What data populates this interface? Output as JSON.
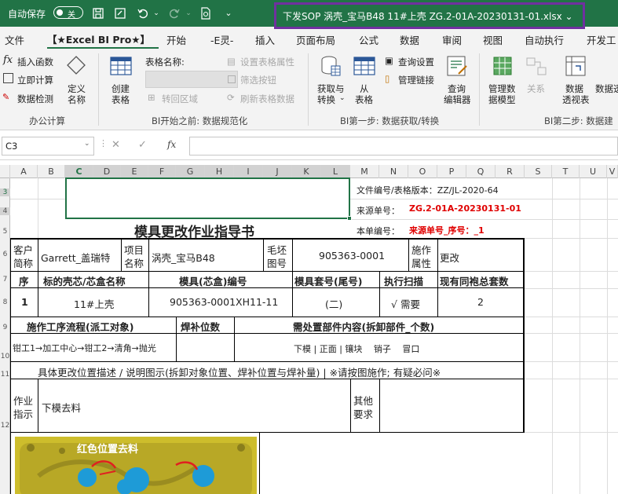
{
  "titlebar": {
    "autosave_label": "自动保存",
    "autosave_state": "关",
    "filename": "下发SOP 涡壳_宝马B48 11#上壳 ZG.2-01A-20230131-01.xlsx ⌄"
  },
  "menu": [
    "文件",
    "【★Excel BI Pro★】",
    "开始",
    "-E灵-",
    "插入",
    "页面布局",
    "公式",
    "数据",
    "审阅",
    "视图",
    "自动执行",
    "开发工"
  ],
  "ribbon": {
    "office_calc": {
      "insert_func": "插入函数",
      "instant_calc": "立即计算",
      "data_check": "数据检测",
      "define_name": [
        "定义",
        "名称"
      ],
      "group": "办公计算"
    },
    "bi_before": {
      "create_table": [
        "创建",
        "表格"
      ],
      "table_name_label": "表格名称:",
      "convert_range": "转回区域",
      "set_props": "设置表格属性",
      "filter_btn": "筛选按钮",
      "refresh": "刷新表格数据",
      "group": "BI开始之前: 数据规范化"
    },
    "bi_step1": {
      "get_transform": [
        "获取与",
        "转换"
      ],
      "from_table": [
        "从",
        "表格"
      ],
      "query_settings": "查询设置",
      "manage_links": "管理链接",
      "query_editor": [
        "查询",
        "编辑器"
      ],
      "group": "BI第一步: 数据获取/转换"
    },
    "bi_step2": {
      "manage_model": [
        "管理数",
        "据模型"
      ],
      "relations": "关系",
      "pivot": [
        "数据",
        "透视表"
      ],
      "pivot2": "数据透",
      "group": "BI第二步: 数据建"
    }
  },
  "formula_bar": {
    "name_box": "C3",
    "cancel": "✕",
    "enter": "✓",
    "fx": "fx",
    "value": ""
  },
  "columns": [
    "A",
    "B",
    "C",
    "D",
    "E",
    "F",
    "G",
    "H",
    "I",
    "J",
    "K",
    "L",
    "M",
    "N",
    "O",
    "P",
    "Q",
    "R",
    "S",
    "T",
    "U",
    "V"
  ],
  "rows": [
    "3",
    "4",
    "5",
    "6",
    "7",
    "8",
    "9",
    "10",
    "11",
    "12"
  ],
  "sheet": {
    "doc_no_label": "文件编号/表格版本：ZZ/JL-2020-64",
    "source_label": "来源单号：",
    "source_value": "ZG.2-01A-20230131-01",
    "this_no_label": "本单编号：",
    "this_no_value": "来源单号_序号：_1",
    "title": "模具更改作业指导书",
    "customer_label": [
      "客户",
      "简称"
    ],
    "customer_value": "Garrett_盖瑞特",
    "project_label": [
      "项目",
      "名称"
    ],
    "project_value": "涡壳_宝马B48",
    "blank_label": [
      "毛坯",
      "图号"
    ],
    "blank_value": "905363-0001",
    "construct_label": [
      "施作",
      "属性"
    ],
    "construct_value": "更改",
    "hdr": [
      "序",
      "标的壳芯/芯盒名称",
      "模具(芯盒)编号",
      "模具套号(尾号)",
      "执行扫描",
      "现有同袍总套数"
    ],
    "row1": [
      "1",
      "11#上壳",
      "905363-0001XH11-11",
      "(二)",
      "√ 需要",
      "2"
    ],
    "process_hdr": "施作工序流程(派工对象)",
    "weld_hdr": "焊补位数",
    "parts_hdr": "需处置部件内容(拆卸部件_个数)",
    "process_value": "钳工1→加工中心→钳工2→清角→抛光",
    "parts_value": "下模 | 正面 | 镶块　 销子　 冒口",
    "desc_row": "具体更改位置描述 / 说明图示(拆卸对象位置、焊补位置与焊补量) | ※请按图施作; 有疑必问※",
    "work_label": [
      "作业",
      "指示"
    ],
    "work_value": "下模去料",
    "other_label": [
      "其他",
      "要求"
    ],
    "image_caption": "红色位置去料"
  }
}
